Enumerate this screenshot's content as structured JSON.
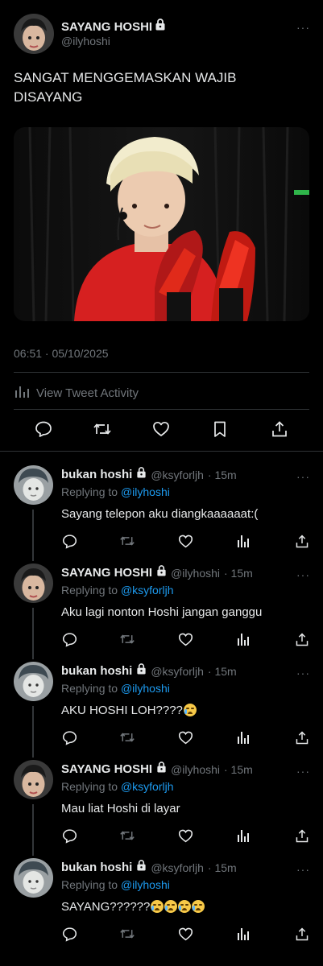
{
  "main": {
    "name": "SAYANG HOSHI",
    "handle": "@ilyhoshi",
    "text_line1": "SANGAT MENGGEMASKAN WAJIB",
    "text_line2": "DISAYANG",
    "timestamp": "06:51 · 05/10/2025",
    "activity_label": "View Tweet Activity",
    "more": "···"
  },
  "replies": [
    {
      "name": "bukan hoshi",
      "handle": "@ksyforljh",
      "time": "· 15m",
      "replying_prefix": "Replying to",
      "mention": "@ilyhoshi",
      "text": "Sayang telepon aku diangkaaaaaat:(",
      "emoji_count": 0,
      "more": "···"
    },
    {
      "name": "SAYANG HOSHI",
      "handle": "@ilyhoshi",
      "time": "· 15m",
      "replying_prefix": "Replying to",
      "mention": "@ksyforljh",
      "text": "Aku lagi nonton Hoshi jangan ganggu",
      "emoji_count": 0,
      "more": "···"
    },
    {
      "name": "bukan hoshi",
      "handle": "@ksyforljh",
      "time": "· 15m",
      "replying_prefix": "Replying to",
      "mention": "@ilyhoshi",
      "text": "AKU HOSHI LOH????",
      "emoji_count": 1,
      "more": "···"
    },
    {
      "name": "SAYANG HOSHI",
      "handle": "@ilyhoshi",
      "time": "· 15m",
      "replying_prefix": "Replying to",
      "mention": "@ksyforljh",
      "text": "Mau liat Hoshi di layar",
      "emoji_count": 0,
      "more": "···"
    },
    {
      "name": "bukan hoshi",
      "handle": "@ksyforljh",
      "time": "· 15m",
      "replying_prefix": "Replying to",
      "mention": "@ilyhoshi",
      "text": "SAYANG??????",
      "emoji_count": 4,
      "more": "···"
    }
  ],
  "colors": {
    "accent": "#1d9bf0",
    "muted": "#71767b",
    "text": "#e7e9ea",
    "background": "#000000"
  }
}
